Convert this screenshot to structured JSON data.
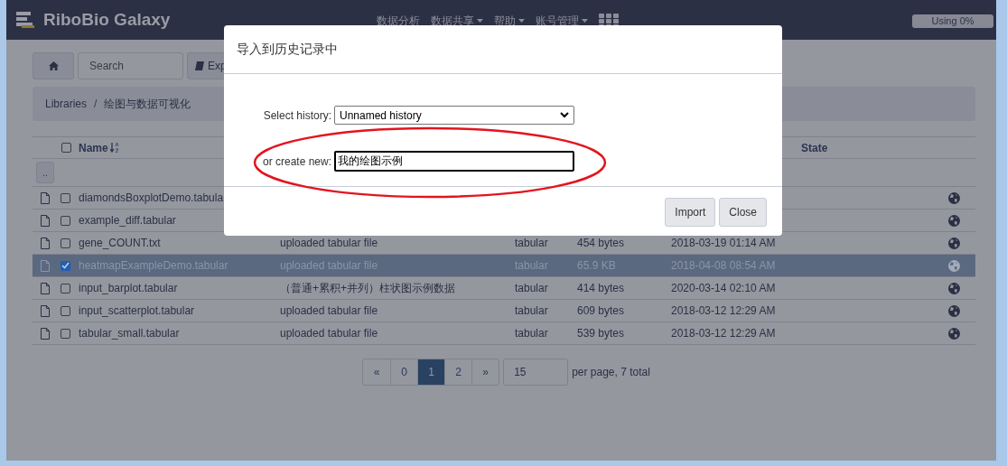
{
  "navbar": {
    "brand": "RiboBio Galaxy",
    "menu": [
      {
        "label": "数据分析",
        "dropdown": false
      },
      {
        "label": "数据共享",
        "dropdown": true
      },
      {
        "label": "帮助",
        "dropdown": true
      },
      {
        "label": "账号管理",
        "dropdown": true
      }
    ],
    "usage": "Using 0%"
  },
  "toolbar": {
    "search": {
      "placeholder": "Search"
    },
    "export_button": "Exp"
  },
  "breadcrumb": {
    "items": [
      "Libraries",
      "绘图与数据可视化"
    ],
    "separator": "/"
  },
  "table": {
    "select_all_checked": false,
    "name_header": "Name",
    "state_header": "State",
    "up_button": "..",
    "rows": [
      {
        "name": "diamondsBoxplotDemo.tabula",
        "checked": false,
        "selected": false
      },
      {
        "name": "example_diff.tabular",
        "checked": false,
        "selected": false
      },
      {
        "name": "gene_COUNT.txt",
        "message": "uploaded tabular file",
        "type": "tabular",
        "size": "454 bytes",
        "date": "2018-03-19 01:14 AM",
        "checked": false,
        "selected": false
      },
      {
        "name": "heatmapExampleDemo.tabular",
        "message": "uploaded tabular file",
        "type": "tabular",
        "size": "65.9 KB",
        "date": "2018-04-08 08:54 AM",
        "checked": true,
        "selected": true
      },
      {
        "name": "input_barplot.tabular",
        "message": "（普通+累积+并列）柱状图示例数据",
        "type": "tabular",
        "size": "414 bytes",
        "date": "2020-03-14 02:10 AM",
        "checked": false,
        "selected": false
      },
      {
        "name": "input_scatterplot.tabular",
        "message": "uploaded tabular file",
        "type": "tabular",
        "size": "609 bytes",
        "date": "2018-03-12 12:29 AM",
        "checked": false,
        "selected": false
      },
      {
        "name": "tabular_small.tabular",
        "message": "uploaded tabular file",
        "type": "tabular",
        "size": "539 bytes",
        "date": "2018-03-12 12:29 AM",
        "checked": false,
        "selected": false
      }
    ]
  },
  "pagination": {
    "pages": [
      {
        "label": "«",
        "selected": false
      },
      {
        "label": "0",
        "selected": false
      },
      {
        "label": "1",
        "selected": true
      },
      {
        "label": "2",
        "selected": false
      },
      {
        "label": "»",
        "selected": false
      }
    ],
    "per_page": "15",
    "summary": "per page, 7 total"
  },
  "dialog": {
    "title": "导入到历史记录中",
    "select_label": "Select history:",
    "select_value": "Unnamed history",
    "new_label": "or create new:",
    "new_value": "我的绘图示例",
    "buttons": [
      "Import",
      "Close"
    ],
    "annotation_circle": true
  }
}
